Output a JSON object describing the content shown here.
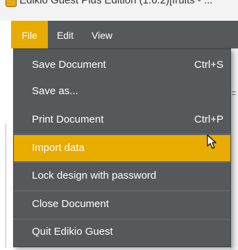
{
  "window": {
    "title": "Edikio Guest Plus Edition (1.6.2)[fruits - ..."
  },
  "menubar": {
    "items": [
      {
        "id": "file",
        "label": "File",
        "active": true
      },
      {
        "id": "edit",
        "label": "Edit",
        "active": false
      },
      {
        "id": "view",
        "label": "View",
        "active": false
      }
    ]
  },
  "file_menu": {
    "items": [
      {
        "label": "Save Document",
        "shortcut": "Ctrl+S",
        "highlighted": false
      },
      {
        "label": "Save as...",
        "shortcut": "",
        "highlighted": false
      },
      {
        "label": "Print Document",
        "shortcut": "Ctrl+P",
        "highlighted": false
      },
      {
        "label": "Import data",
        "shortcut": "",
        "highlighted": true
      },
      {
        "label": "Lock design with password",
        "shortcut": "",
        "highlighted": false
      },
      {
        "label": "Close Document",
        "shortcut": "",
        "highlighted": false
      },
      {
        "label": "Quit Edikio Guest",
        "shortcut": "",
        "highlighted": false
      }
    ]
  },
  "colors": {
    "menu_bg": "#55595c",
    "highlight": "#e8ac00",
    "text": "#ffffff"
  },
  "icons": {
    "app": "edikio-app-icon",
    "pointer": "arrow-cursor-icon"
  }
}
